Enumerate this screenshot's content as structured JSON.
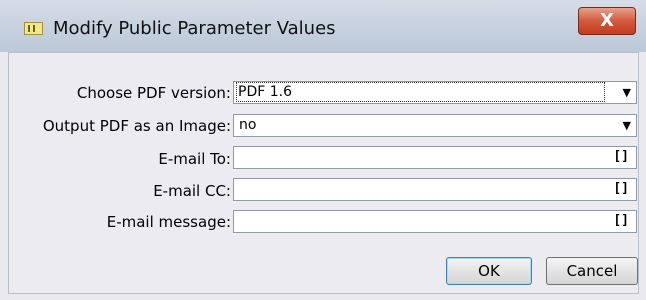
{
  "window": {
    "title": "Modify Public Parameter Values",
    "close_label": "X"
  },
  "form": {
    "rows": [
      {
        "label": "Choose PDF version:",
        "value": "PDF 1.6",
        "control": "dropdown",
        "indicator": "▼"
      },
      {
        "label": "Output PDF as an Image:",
        "value": "no",
        "control": "dropdown",
        "indicator": "▼"
      },
      {
        "label": "E-mail To:",
        "value": "",
        "control": "text-with-list",
        "indicator": "[]"
      },
      {
        "label": "E-mail CC:",
        "value": "",
        "control": "text-with-list",
        "indicator": "[]"
      },
      {
        "label": "E-mail message:",
        "value": "",
        "control": "text-with-list",
        "indicator": "[]"
      }
    ]
  },
  "buttons": {
    "ok_label": "OK",
    "cancel_label": "Cancel"
  },
  "icons": {
    "app": "parameter-dialog-icon",
    "close": "close-icon",
    "dropdown": "dropdown-arrow-icon",
    "list": "list-brackets-icon"
  },
  "colors": {
    "close_button": "#c33a1e",
    "titlebar": "#c9d3e0",
    "dialog_background": "#ececf0",
    "ok_focus_border": "#3c7fb1"
  }
}
